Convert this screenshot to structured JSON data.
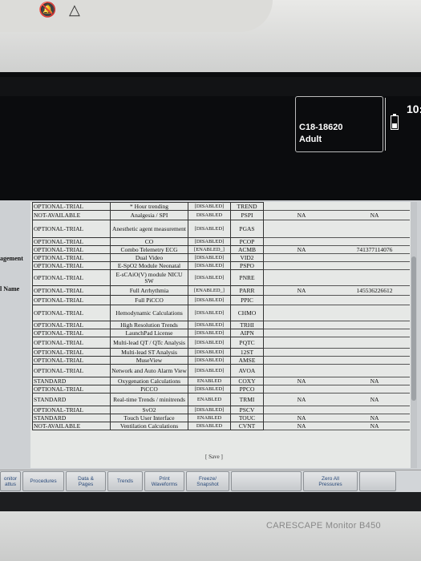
{
  "status": {
    "patient_id": "C18-18620",
    "category": "Adult",
    "time": "10:"
  },
  "side_labels": [
    "agement",
    "l Name"
  ],
  "rows": [
    {
      "state": "OPTIONAL-TRIAL",
      "feature": "* Hour trending",
      "enabled": "[DISABLED]",
      "code": "TREND",
      "c1": "",
      "c2": ""
    },
    {
      "state": "NOT-AVAILABLE",
      "feature": "Analgesia / SPI",
      "enabled": "DISABLED",
      "code": "PSPI",
      "c1": "NA",
      "c2": "NA"
    },
    {
      "state": "OPTIONAL-TRIAL",
      "feature": "Anesthetic agent measurement",
      "enabled": "[DISABLED]",
      "code": "PGAS",
      "c1": "",
      "c2": ""
    },
    {
      "state": "OPTIONAL-TRIAL",
      "feature": "CO",
      "enabled": "[DISABLED]",
      "code": "PCOP",
      "c1": "",
      "c2": ""
    },
    {
      "state": "OPTIONAL-TRIAL",
      "feature": "Combo Telemetry ECG",
      "enabled": "[ENABLED_]",
      "code": "ACMB",
      "c1": "NA",
      "c2": "741377114076"
    },
    {
      "state": "OPTIONAL-TRIAL",
      "feature": "Dual Video",
      "enabled": "[DISABLED]",
      "code": "VID2",
      "c1": "",
      "c2": ""
    },
    {
      "state": "OPTIONAL-TRIAL",
      "feature": "E-SpO2 Module Neonatal",
      "enabled": "[DISABLED]",
      "code": "PSPO",
      "c1": "",
      "c2": ""
    },
    {
      "state": "OPTIONAL-TRIAL",
      "feature": "E-sCAiO(V) module NICU SW",
      "enabled": "[DISABLED]",
      "code": "PNRE",
      "c1": "",
      "c2": ""
    },
    {
      "state": "OPTIONAL-TRIAL",
      "feature": "Full Arrhythmia",
      "enabled": "[ENABLED_]",
      "code": "PARR",
      "c1": "NA",
      "c2": "145536226612"
    },
    {
      "state": "OPTIONAL-TRIAL",
      "feature": "Full PiCCO",
      "enabled": "[DISABLED]",
      "code": "PPIC",
      "c1": "",
      "c2": ""
    },
    {
      "state": "OPTIONAL-TRIAL",
      "feature": "Hemodynamic Calculations",
      "enabled": "[DISABLED]",
      "code": "CHMO",
      "c1": "",
      "c2": ""
    },
    {
      "state": "OPTIONAL-TRIAL",
      "feature": "High Resolution Trends",
      "enabled": "[DISABLED]",
      "code": "TRHI",
      "c1": "",
      "c2": ""
    },
    {
      "state": "OPTIONAL-TRIAL",
      "feature": "LaunchPad License",
      "enabled": "[DISABLED]",
      "code": "AIPN",
      "c1": "",
      "c2": ""
    },
    {
      "state": "OPTIONAL-TRIAL",
      "feature": "Multi-lead QT / QTc Analysis",
      "enabled": "[DISABLED]",
      "code": "PQTC",
      "c1": "",
      "c2": ""
    },
    {
      "state": "OPTIONAL-TRIAL",
      "feature": "Multi-lead ST Analysis",
      "enabled": "[DISABLED]",
      "code": "12ST",
      "c1": "",
      "c2": ""
    },
    {
      "state": "OPTIONAL-TRIAL",
      "feature": "MuseView",
      "enabled": "[DISABLED]",
      "code": "AMSE",
      "c1": "",
      "c2": ""
    },
    {
      "state": "OPTIONAL-TRIAL",
      "feature": "Network and Auto Alarm View",
      "enabled": "[DISABLED]",
      "code": "AVOA",
      "c1": "",
      "c2": ""
    },
    {
      "state": "STANDARD",
      "feature": "Oxygenation Calculations",
      "enabled": "ENABLED",
      "code": "COXY",
      "c1": "NA",
      "c2": "NA"
    },
    {
      "state": "OPTIONAL-TRIAL",
      "feature": "PiCCO",
      "enabled": "[DISABLED]",
      "code": "PPCO",
      "c1": "",
      "c2": ""
    },
    {
      "state": "STANDARD",
      "feature": "Real-time Trends / minitrends",
      "enabled": "ENABLED",
      "code": "TRMI",
      "c1": "NA",
      "c2": "NA"
    },
    {
      "state": "OPTIONAL-TRIAL",
      "feature": "SvO2",
      "enabled": "[DISABLED]",
      "code": "PSCV",
      "c1": "",
      "c2": ""
    },
    {
      "state": "STANDARD",
      "feature": "Touch User Interface",
      "enabled": "ENABLED",
      "code": "TOUC",
      "c1": "NA",
      "c2": "NA"
    },
    {
      "state": "NOT-AVAILABLE",
      "feature": "Ventilation Calculations",
      "enabled": "DISABLED",
      "code": "CVNT",
      "c1": "NA",
      "c2": "NA"
    }
  ],
  "save_label": "[ Save ]",
  "menu": [
    {
      "label": "onitor\nattus"
    },
    {
      "label": "Procedures"
    },
    {
      "label": "Data &\nPages"
    },
    {
      "label": "Trends"
    },
    {
      "label": "Print\nWaveforms"
    },
    {
      "label": "Freeze/\nSnapshot"
    },
    {
      "label": ""
    },
    {
      "label": "Zero All\nPressures"
    },
    {
      "label": ""
    }
  ],
  "brand": "CARESCAPE Monitor B450"
}
